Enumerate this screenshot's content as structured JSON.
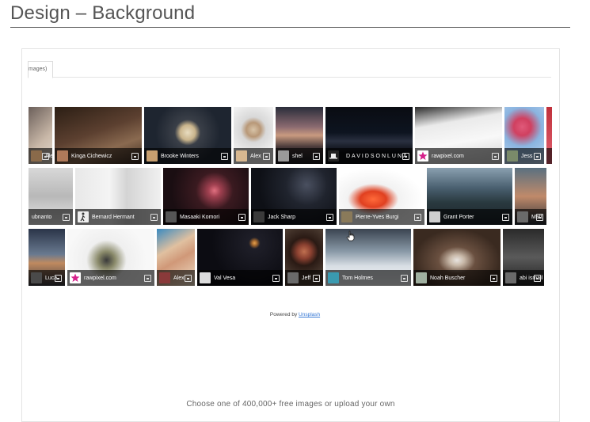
{
  "page": {
    "title": "Design – Background"
  },
  "tab": {
    "label": "mages)"
  },
  "rows": [
    [
      {
        "w": 30,
        "bg": "linear-gradient(135deg,#6b5f5a,#c9b8a8 60%,#e2d8cc)",
        "photographer": "Alex",
        "avatar": "#8a6a4a",
        "avatar_style": "plain"
      },
      {
        "w": 110,
        "bg": "linear-gradient(160deg,#2b1e14,#5c4030 45%,#8a6a50 70%,#3a2a20)",
        "photographer": "Kinga Cichewicz",
        "avatar": "#b07a5a",
        "avatar_style": "plain"
      },
      {
        "w": 110,
        "bg": "radial-gradient(circle at 50% 45%,#e8dcc0 0,#c9b48c 14%,#3a3f48 24%,#1e2530 60%)",
        "photographer": "Brooke Winters",
        "avatar": "#c8a070",
        "avatar_style": "plain"
      },
      {
        "w": 50,
        "bg": "radial-gradient(circle at 50% 40%,#d8c4a8 0,#b89878 18%,#d8d8d8 32%,#f0f0f0 70%)",
        "photographer": "Alex",
        "avatar": "#d8b890",
        "avatar_style": "plain"
      },
      {
        "w": 60,
        "bg": "linear-gradient(180deg,#2a2d3a 0,#8a6a70 35%,#c99a80 50%,#4a3a3a 70%,#1a1a1e)",
        "photographer": "shel",
        "avatar": "#9a9a9a",
        "avatar_style": "plain"
      },
      {
        "w": 110,
        "bg": "linear-gradient(180deg,#0a0c12 0,#0d1420 45%,#2a3040 60%,#0a0c12 80%)",
        "photographer": "DAVIDSONLUNA",
        "avatar": "#222",
        "avatar_style": "hat"
      },
      {
        "w": 110,
        "bg": "linear-gradient(170deg,#2a2a2a 0,#eaeaea 30%,#f8f8f8 60%,#d0d0d0)",
        "photographer": "rawpixel.com",
        "avatar": "#ffffff",
        "avatar_style": "star"
      },
      {
        "w": 50,
        "bg": "radial-gradient(circle at 45% 35%,#e05a7a 0,#d04060 20%,#8ab4e0 45%,#c0d8f0)",
        "photographer": "Jess",
        "avatar": "#7a8a6a",
        "avatar_style": "plain"
      },
      {
        "w": 20,
        "bg": "linear-gradient(180deg,#c0303a,#e06070)",
        "photographer": "",
        "avatar": "#999",
        "avatar_style": "none"
      }
    ],
    [
      {
        "w": 56,
        "bg": "linear-gradient(180deg,#d8d8d8,#b8b8b8 50%,#e8e8e8)",
        "photographer": "ubnanto",
        "avatar": "#999",
        "avatar_style": "none"
      },
      {
        "w": 108,
        "bg": "linear-gradient(90deg,#e8e8e8 0,#f4f4f4 40%,#d4d4d4 60%,#f0f0f0)",
        "photographer": "Bernard Hermant",
        "avatar": "#eeeeee",
        "avatar_style": "walker"
      },
      {
        "w": 108,
        "bg": "radial-gradient(circle at 60% 40%,#e07080 0,#a04050 10%,#3a1a20 30%,#1a0e12 70%)",
        "photographer": "Masaaki Komori",
        "avatar": "#555",
        "avatar_style": "plain"
      },
      {
        "w": 108,
        "bg": "radial-gradient(circle at 65% 30%,#4a5060 0,#20242e 30%,#0e1016 70%)",
        "photographer": "Jack Sharp",
        "avatar": "#3a3a3a",
        "avatar_style": "plain"
      },
      {
        "w": 108,
        "bg": "radial-gradient(ellipse at 40% 55%,#ff6a3a 0,#e04020 18%,#f2f2f2 35%,#ffffff 70%)",
        "photographer": "Pierre-Yves Burgi",
        "avatar": "#8a7a5a",
        "avatar_style": "plain"
      },
      {
        "w": 108,
        "bg": "linear-gradient(180deg,#8aa0b0 0,#4a6070 35%,#2a3a40 60%,#1a2228)",
        "photographer": "Grant Porter",
        "avatar": "#cfcfcf",
        "avatar_style": "plain"
      },
      {
        "w": 40,
        "bg": "linear-gradient(180deg,#5a7080,#c08a6a 50%,#2a3038)",
        "photographer": "Matt",
        "avatar": "#6a6a6a",
        "avatar_style": "plain"
      }
    ],
    [
      {
        "w": 46,
        "bg": "linear-gradient(180deg,#2a3448 0,#6a7a90 45%,#c08a60 60%,#3a3a40)",
        "photographer": "Luca",
        "avatar": "#4a4a4a",
        "avatar_style": "plain"
      },
      {
        "w": 110,
        "bg": "radial-gradient(circle at 45% 55%,#3a3a3a 0,#8a8a6a 15%,#efefef 35%,#f8f8f8 70%)",
        "photographer": "rawpixel.com",
        "avatar": "#ffffff",
        "avatar_style": "star"
      },
      {
        "w": 48,
        "bg": "linear-gradient(150deg,#3a8ac0 0,#e0c0a0 35%,#d09878 55%,#f0e0c8)",
        "photographer": "Alex",
        "avatar": "#8a3a3a",
        "avatar_style": "plain"
      },
      {
        "w": 108,
        "bg": "radial-gradient(circle at 67% 25%,#e0a050 0,#b07030 3%,#1e1e28 8%,#0c0c12 60%)",
        "photographer": "Val Vesa",
        "avatar": "#dcdcdc",
        "avatar_style": "plain"
      },
      {
        "w": 48,
        "bg": "radial-gradient(circle at 50% 40%,#c07050 0,#8a4030 18%,#2a1a14 36%,#4a3a30 70%)",
        "photographer": "Jeff",
        "avatar": "#6a6a6a",
        "avatar_style": "plain"
      },
      {
        "w": 108,
        "bg": "linear-gradient(180deg,#3a4450 0,#8a9aa8 40%,#d8dee4 65%,#f2f4f6)",
        "photographer": "Tom Holmes",
        "avatar": "#3a9ab0",
        "avatar_style": "plain"
      },
      {
        "w": 110,
        "bg": "radial-gradient(ellipse at 50% 55%,#e8e4e0 0,#c8b8a8 12%,#6a5040 30%,#3a2a20 70%)",
        "photographer": "Noah Buscher",
        "avatar": "#a0b0a0",
        "avatar_style": "plain"
      },
      {
        "w": 52,
        "bg": "linear-gradient(180deg,#2a2a2a,#5a5a5a 50%,#1e1e1e)",
        "photographer": "abi ismail",
        "avatar": "#6a6a6a",
        "avatar_style": "plain"
      }
    ]
  ],
  "powered": {
    "prefix": "Powered by ",
    "link": "Unsplash"
  },
  "footer": {
    "text": "Choose one of 400,000+ free images or upload your own"
  }
}
